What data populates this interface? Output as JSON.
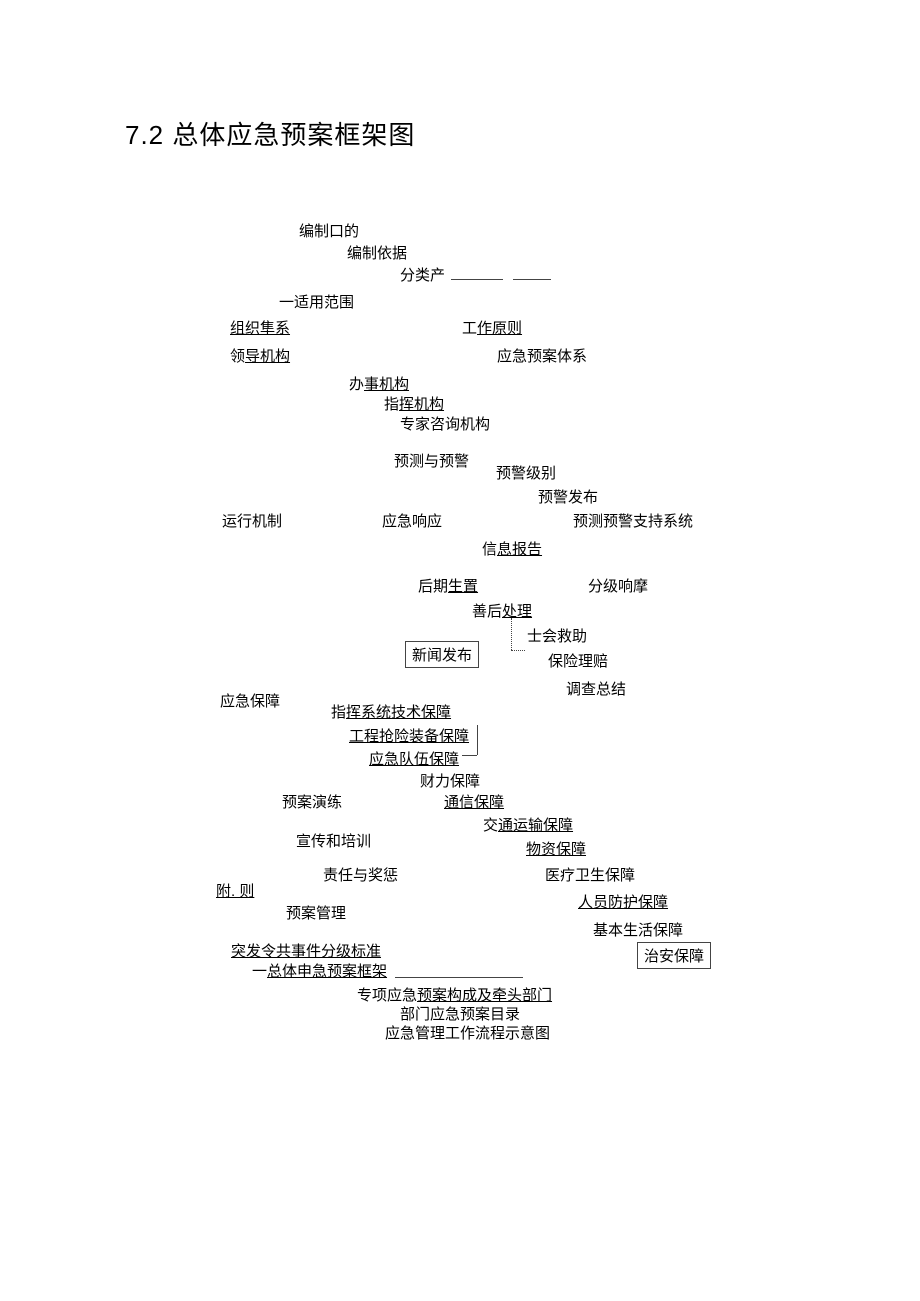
{
  "title": "7.2 总体应急预案框架图",
  "nodes": {
    "n1": "编制口的",
    "n2": "编制依据",
    "n3": "分类产",
    "n4": "一适用范围",
    "n5": "组织隼系",
    "n6": "领导机构",
    "n7": "工作原则",
    "n8": "应急预案体系",
    "n9": "办事机构",
    "n10": "指挥机构",
    "n11": "专家咨询机构",
    "n12": "预测与预警",
    "n13": "预警级别",
    "n14": "预警发布",
    "n15": "运行机制",
    "n16": "应急响应",
    "n17": "预测预警支持系统",
    "n18": "信息报告",
    "n19": "后期生置",
    "n20": "分级响摩",
    "n21": "善后处理",
    "n22": "士会救助",
    "n23": "新闻发布",
    "n24": "保险理赔",
    "n25": "调查总结",
    "n26": "应急保障",
    "n27": "指挥系统技术保障",
    "n28": "工程抢险装备保障 ",
    "n29": "应急队伍保障",
    "n30": "财力保障",
    "n31": "预案演练",
    "n32": "通信保障",
    "n33": "交通运输保障",
    "n34": "宣传和培训",
    "n35": "物资保障",
    "n36": "责任与奖惩",
    "n37": "医疗卫生保障",
    "n38": "附. 则",
    "n39": "人员防护保障",
    "n40": "预案管理",
    "n41": "基本生活保障",
    "n42": "突发令共事件分级标准",
    "n43": "治安保障",
    "n44": "一总体申急预案框架",
    "n45": "专项应急预案构成及牵头部门",
    "n46": "部门应急预案目录",
    "n47": "应急管理工作流程示意图"
  }
}
